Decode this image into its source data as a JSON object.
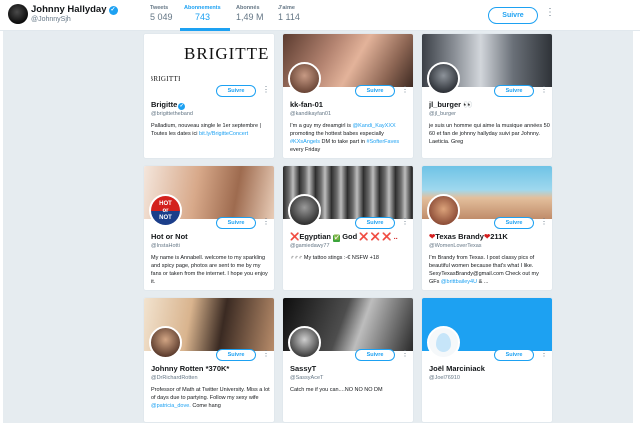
{
  "header": {
    "name": "Johnny Hallyday",
    "handle": "@JohnnySjh",
    "follow_label": "Suivre",
    "stats": [
      {
        "label": "Tweets",
        "value": "5 049"
      },
      {
        "label": "Abonnements",
        "value": "743"
      },
      {
        "label": "Abonnés",
        "value": "1,49 M"
      },
      {
        "label": "J'aime",
        "value": "1 114"
      }
    ],
    "active_stat": "Abonnements"
  },
  "colors": {
    "accent": "#1da1f2",
    "background": "#e6ecf0"
  },
  "cards": [
    {
      "name": "Brigitte",
      "handle": "@brigittetheband",
      "verified": true,
      "banner_text": "BRIGITTE",
      "avatar_text": "BRIGITTE",
      "follow_label": "Suivre",
      "bio": "Palladium, nouveau single le 1er septembre | Toutes les dates ici",
      "bio_link": "bit.ly/BrigitteConcert"
    },
    {
      "name": "kk-fan-01",
      "handle": "@kandikayfan01",
      "follow_label": "Suivre",
      "bio_1": "I'm a guy my dreamgirl is",
      "bio_link_1": "@Kandi_KayXXX",
      "bio_2": "promoting the hottest babes especially",
      "bio_link_2": "#KXsAngels",
      "bio_3": "DM to take part in",
      "bio_link_3": "#SofterFaves",
      "bio_4": "every Friday"
    },
    {
      "name": "jl_burger",
      "name_emoji": "👀",
      "handle": "@jl_burger",
      "follow_label": "Suivre",
      "bio": "je suis un homme qui aime la musique années 50 60 et fan de johnny hallyday suivi par Johnny. Laeticia. Greg"
    },
    {
      "name": "Hot or Not",
      "handle": "@InstaHotti",
      "avatar_text_1": "HOT",
      "avatar_text_2": "or",
      "avatar_text_3": "NOT",
      "follow_label": "Suivre",
      "bio": "My name is Annabell. welcome to my sparkling and spicy page, photos are sent to me by my fans or taken from the internet. I hope you enjoy it."
    },
    {
      "name_prefix": "❌",
      "name": "Egyptian",
      "name_mid_emoji": "✅",
      "name_2": "God",
      "name_suffix": "❌ ❌ ❌ ..",
      "handle": "@gamiedawy77",
      "follow_label": "Suivre",
      "bio": "♂♂♂ My tattoo stings :-€ NSFW +18"
    },
    {
      "name_prefix": "❤",
      "name": "Texas Brandy",
      "name_suffix": "❤",
      "name_count": "211K",
      "handle": "@WomenLoverTexas",
      "follow_label": "Suivre",
      "bio": "I'm Brandy from Texas. I post classy pics of beautiful women because that's what I like. SexyTexasBrandy@gmail.com Check out my GFs",
      "bio_link": "@brittbailey4U",
      "bio_end": "& ..."
    },
    {
      "name": "Johnny Rotten *370K*",
      "handle": "@DrRichardRotten",
      "follow_label": "Suivre",
      "bio": "Professor of Math at Twitter University. Miss a lot of days due to partying. Follow my sexy wife",
      "bio_link": "@patricia_dove.",
      "bio_end": "Come hang"
    },
    {
      "name": "SassyT",
      "handle": "@SassyAceT",
      "follow_label": "Suivre",
      "bio": "Catch me if you can....NO NO NO DM"
    },
    {
      "name": "Joël Marciniack",
      "handle": "@Joel76910",
      "follow_label": "Suivre",
      "bio": ""
    }
  ]
}
